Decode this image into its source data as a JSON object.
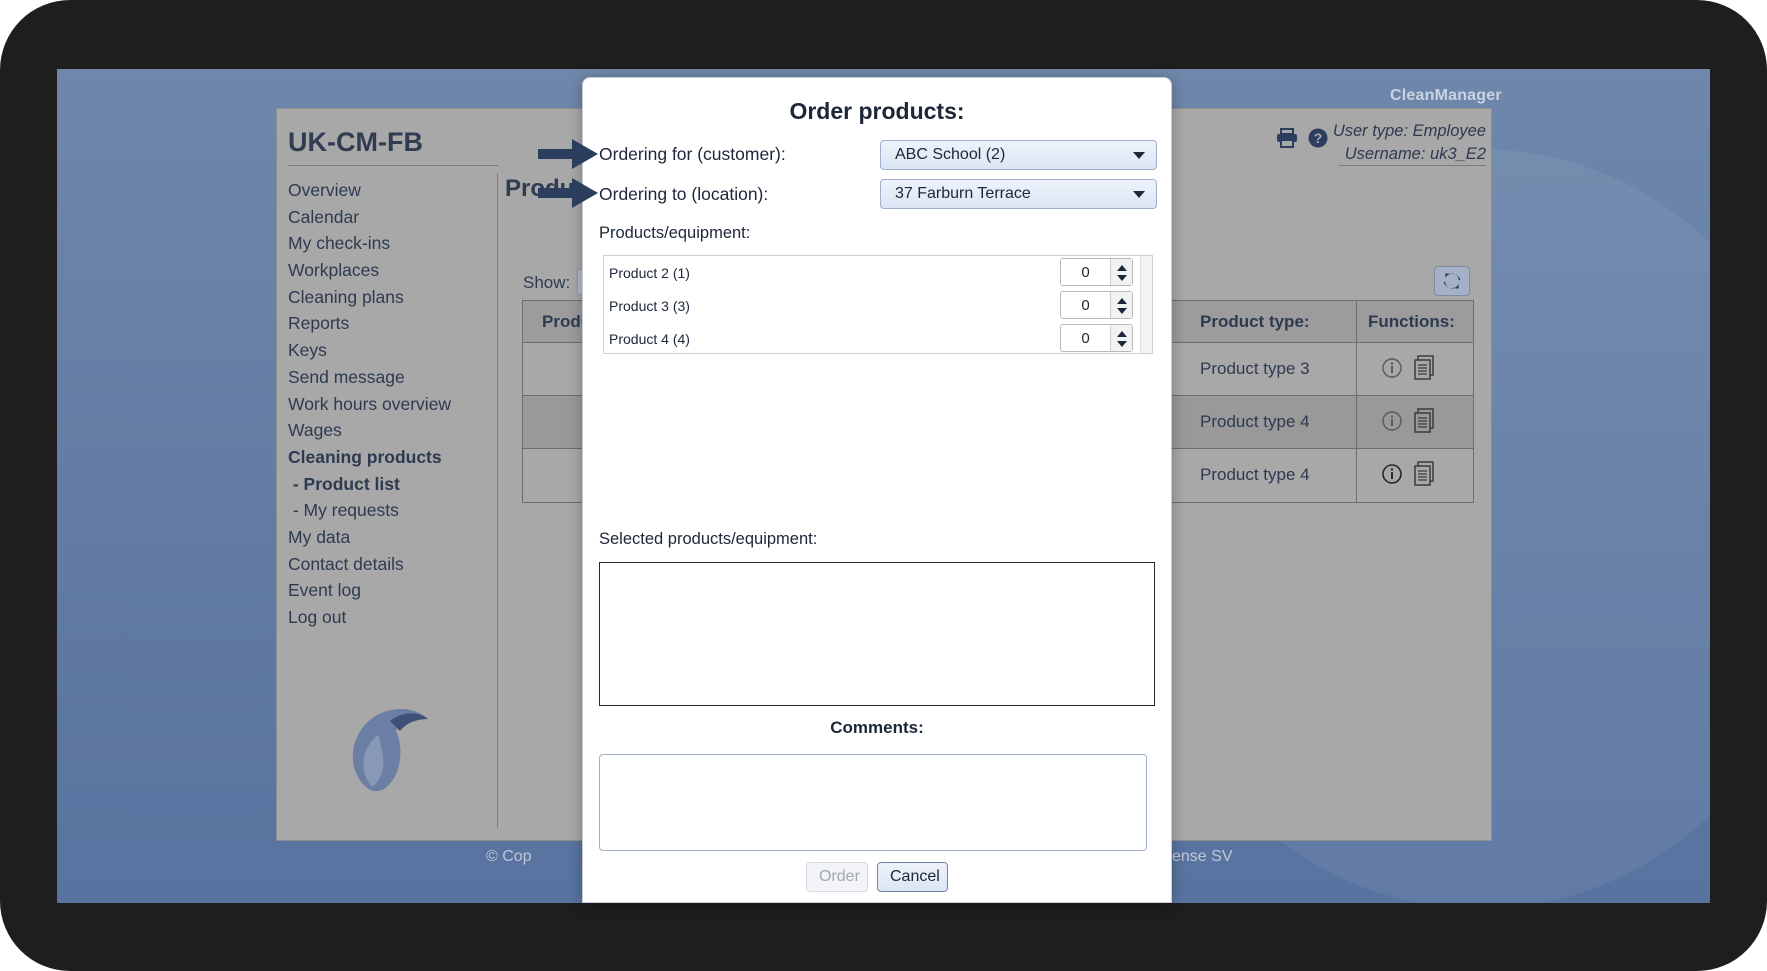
{
  "brand": "CleanManager",
  "app": {
    "title": "UK-CM-FB",
    "heading": "Produ",
    "show_label": "Show:",
    "user_type": "User type: Employee",
    "username": "Username: uk3_E2",
    "footer_left": "© Cop",
    "footer_right": "ense SV"
  },
  "sidebar": {
    "items": [
      {
        "label": "Overview"
      },
      {
        "label": "Calendar"
      },
      {
        "label": "My check-ins"
      },
      {
        "label": "Workplaces"
      },
      {
        "label": "Cleaning plans"
      },
      {
        "label": "Reports"
      },
      {
        "label": "Keys"
      },
      {
        "label": "Send message"
      },
      {
        "label": "Work hours overview"
      },
      {
        "label": "Wages"
      },
      {
        "label": "Cleaning products"
      },
      {
        "label": " - Product list"
      },
      {
        "label": " - My requests"
      },
      {
        "label": "My data"
      },
      {
        "label": "Contact details"
      },
      {
        "label": "Event log"
      },
      {
        "label": "Log out"
      }
    ]
  },
  "table": {
    "headers": {
      "product": "Produ",
      "type": "Product type:",
      "functions": "Functions:"
    },
    "rows": [
      {
        "type": "Product type 3"
      },
      {
        "type": "Product type 4"
      },
      {
        "type": "Product type 4"
      }
    ]
  },
  "modal": {
    "title": "Order products:",
    "customer_label": "Ordering for (customer):",
    "customer_value": "ABC School (2)",
    "location_label": "Ordering to (location):",
    "location_value": "37 Farburn Terrace",
    "products_label": "Products/equipment:",
    "products": [
      {
        "name": "Product 2 (1)",
        "qty": "0"
      },
      {
        "name": "Product 3 (3)",
        "qty": "0"
      },
      {
        "name": "Product 4 (4)",
        "qty": "0"
      }
    ],
    "selected_label": "Selected products/equipment:",
    "comments_label": "Comments:",
    "order_button": "Order",
    "cancel_button": "Cancel"
  },
  "colors": {
    "accent": "#2b3e5e",
    "overlay_bg": "#6f87ab"
  }
}
